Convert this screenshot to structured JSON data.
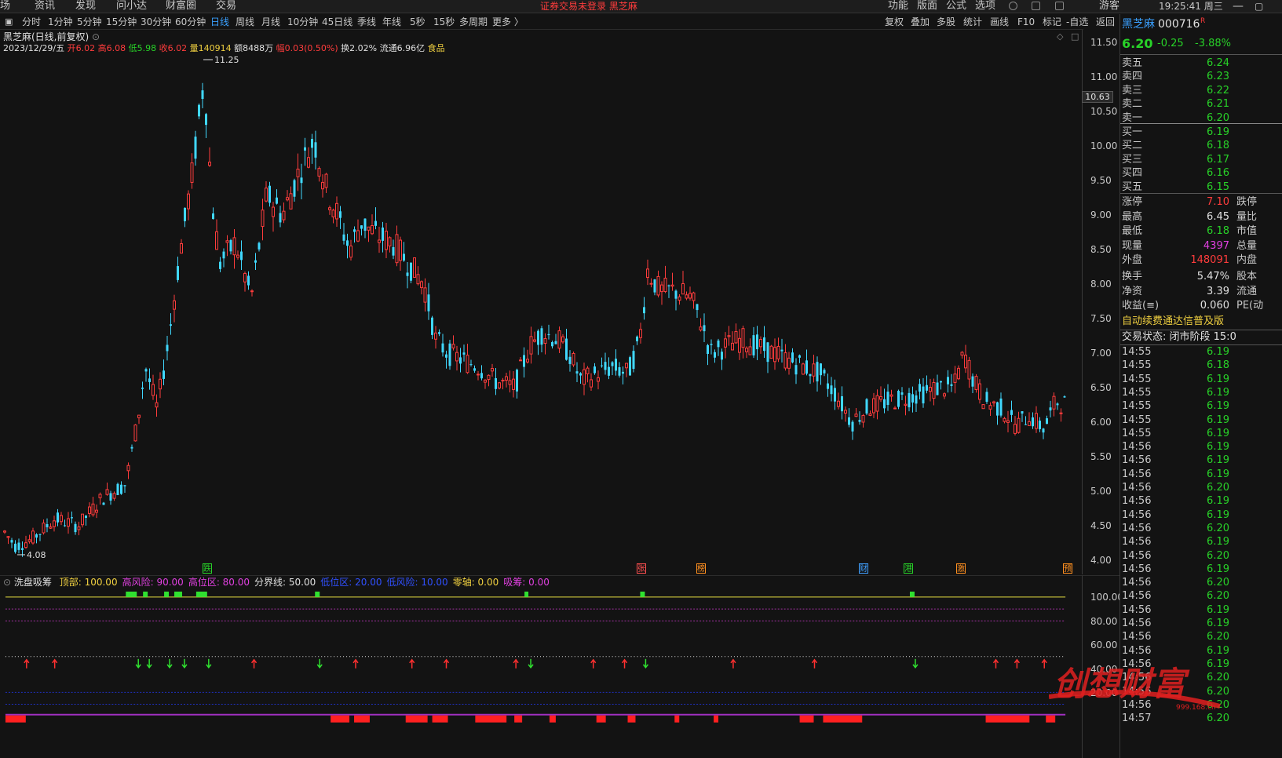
{
  "top_menu": [
    "场",
    "资讯",
    "发现",
    "问小达",
    "财富圈",
    "交易"
  ],
  "top_notice": "证券交易未登录 黑芝麻",
  "top_right_menu": [
    "功能",
    "版面",
    "公式",
    "选项"
  ],
  "user": "游客",
  "clock": "19:25:41 周三",
  "periods": [
    "分时",
    "1分钟",
    "5分钟",
    "15分钟",
    "30分钟",
    "60分钟",
    "日线",
    "周线",
    "月线",
    "10分钟",
    "45日线",
    "季线",
    "年线",
    "5秒",
    "15秒",
    "多周期",
    "更多 〉"
  ],
  "active_period": "日线",
  "toolbar": [
    "复权",
    "叠加",
    "多股",
    "统计",
    "画线",
    "F10",
    "标记",
    "-自选",
    "返回"
  ],
  "stock": {
    "name": "黑芝麻",
    "code": "000716",
    "period_label": "黑芝麻(日线,前复权)"
  },
  "ohlc": {
    "date": "2023/12/29/五",
    "open": "开6.02",
    "high": "高6.08",
    "low": "低5.98",
    "close": "收6.02",
    "vol": "量140914",
    "amount": "额8488万",
    "range": "幅0.03(0.50%)",
    "turnover": "换2.02%",
    "float": "流通6.96亿",
    "sector": "食品"
  },
  "y_axis": [
    "11.50",
    "11.00",
    "10.50",
    "10.00",
    "9.50",
    "9.00",
    "8.50",
    "8.00",
    "7.50",
    "7.00",
    "6.50",
    "6.00",
    "5.50",
    "5.00",
    "4.50",
    "4.00"
  ],
  "price_tag": "10.63",
  "high_label": "11.25",
  "low_label": "4.08",
  "events": [
    {
      "t": "跌",
      "c": "#28d228"
    },
    {
      "t": "张",
      "c": "#ff5050"
    },
    {
      "t": "榜",
      "c": "#ff9020"
    },
    {
      "t": "财",
      "c": "#40a0ff"
    },
    {
      "t": "港",
      "c": "#28d228"
    },
    {
      "t": "激",
      "c": "#ff9020"
    },
    {
      "t": "预",
      "c": "#ff9020"
    }
  ],
  "indicator": {
    "name": "洗盘吸筹",
    "params": [
      {
        "label": "顶部: 100.00",
        "color": "#f0d040"
      },
      {
        "label": "高风险: 90.00",
        "color": "#e040e0"
      },
      {
        "label": "高位区: 80.00",
        "color": "#e040e0"
      },
      {
        "label": "分界线: 50.00",
        "color": "#e0e0e0"
      },
      {
        "label": "低位区: 20.00",
        "color": "#3050ff"
      },
      {
        "label": "低风险: 10.00",
        "color": "#3050ff"
      },
      {
        "label": "零轴: 0.00",
        "color": "#f0d040"
      },
      {
        "label": "吸筹: 0.00",
        "color": "#e040e0"
      }
    ],
    "y_axis": [
      "100.00",
      "80.00",
      "60.00",
      "40.00",
      "20.00"
    ]
  },
  "quote": {
    "name": "黑芝麻",
    "code": "000716",
    "flag": "R",
    "price": "6.20",
    "change": "-0.25",
    "pct": "-3.88%",
    "asks": [
      {
        "l": "卖五",
        "p": "6.24"
      },
      {
        "l": "卖四",
        "p": "6.23"
      },
      {
        "l": "卖三",
        "p": "6.22"
      },
      {
        "l": "卖二",
        "p": "6.21"
      },
      {
        "l": "卖一",
        "p": "6.20"
      }
    ],
    "bids": [
      {
        "l": "买一",
        "p": "6.19"
      },
      {
        "l": "买二",
        "p": "6.18"
      },
      {
        "l": "买三",
        "p": "6.17"
      },
      {
        "l": "买四",
        "p": "6.16"
      },
      {
        "l": "买五",
        "p": "6.15"
      }
    ],
    "stats": [
      {
        "l": "涨停",
        "v": "7.10",
        "c": "#ff3c3c",
        "x": "跌停"
      },
      {
        "l": "最高",
        "v": "6.45",
        "c": "#e0e0e0",
        "x": "量比"
      },
      {
        "l": "最低",
        "v": "6.18",
        "c": "#28d228",
        "x": "市值"
      },
      {
        "l": "现量",
        "v": "4397",
        "c": "#e040e0",
        "x": "总量"
      },
      {
        "l": "外盘",
        "v": "148091",
        "c": "#ff3c3c",
        "x": "内盘"
      },
      {
        "l": "换手",
        "v": "5.47%",
        "c": "#e0e0e0",
        "x": "股本"
      },
      {
        "l": "净资",
        "v": "3.39",
        "c": "#e0e0e0",
        "x": "流通"
      },
      {
        "l": "收益(≡)",
        "v": "0.060",
        "c": "#e0e0e0",
        "x": "PE(动"
      }
    ],
    "promo": "自动续费通达信普及版",
    "status": "交易状态: 闭市阶段 15:0",
    "ticks": [
      {
        "t": "14:55",
        "p": "6.19"
      },
      {
        "t": "14:55",
        "p": "6.18"
      },
      {
        "t": "14:55",
        "p": "6.19"
      },
      {
        "t": "14:55",
        "p": "6.19"
      },
      {
        "t": "14:55",
        "p": "6.19"
      },
      {
        "t": "14:55",
        "p": "6.19"
      },
      {
        "t": "14:55",
        "p": "6.19"
      },
      {
        "t": "14:56",
        "p": "6.19"
      },
      {
        "t": "14:56",
        "p": "6.19"
      },
      {
        "t": "14:56",
        "p": "6.19"
      },
      {
        "t": "14:56",
        "p": "6.20"
      },
      {
        "t": "14:56",
        "p": "6.19"
      },
      {
        "t": "14:56",
        "p": "6.19"
      },
      {
        "t": "14:56",
        "p": "6.20"
      },
      {
        "t": "14:56",
        "p": "6.19"
      },
      {
        "t": "14:56",
        "p": "6.20"
      },
      {
        "t": "14:56",
        "p": "6.19"
      },
      {
        "t": "14:56",
        "p": "6.20"
      },
      {
        "t": "14:56",
        "p": "6.20"
      },
      {
        "t": "14:56",
        "p": "6.19"
      },
      {
        "t": "14:56",
        "p": "6.19"
      },
      {
        "t": "14:56",
        "p": "6.20"
      },
      {
        "t": "14:56",
        "p": "6.19"
      },
      {
        "t": "14:56",
        "p": "6.19"
      },
      {
        "t": "14:56",
        "p": "6.20"
      },
      {
        "t": "14:56",
        "p": "6.20"
      },
      {
        "t": "14:56",
        "p": "6.20"
      },
      {
        "t": "14:57",
        "p": "6.20"
      }
    ]
  },
  "watermark": {
    "text": "创想财富",
    "url": "999.168.cn"
  }
}
